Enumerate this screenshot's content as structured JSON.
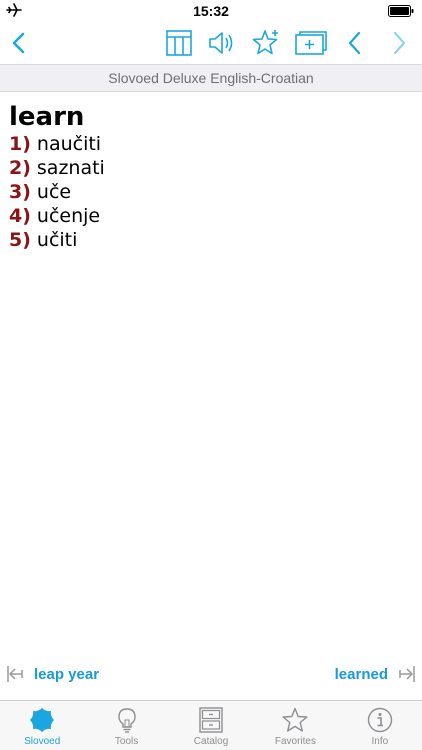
{
  "status": {
    "time": "15:32"
  },
  "toolbar": {
    "icons": [
      "back-icon",
      "table-icon",
      "speaker-icon",
      "favorite-star-icon",
      "add-card-icon",
      "prev-icon",
      "next-icon"
    ],
    "accent": "#1ba6e0"
  },
  "header": {
    "title": "Slovoed Deluxe English-Croatian"
  },
  "entry": {
    "headword": "learn",
    "senses": [
      {
        "num": "1)",
        "text": "naučiti"
      },
      {
        "num": "2)",
        "text": "saznati"
      },
      {
        "num": "3)",
        "text": "uče"
      },
      {
        "num": "4)",
        "text": "učenje"
      },
      {
        "num": "5)",
        "text": "učiti"
      }
    ],
    "number_color": "#8a1515"
  },
  "nav": {
    "prev": "leap year",
    "next": "learned"
  },
  "tabs": [
    {
      "label": "Slovoed",
      "icon": "slovoed-icon",
      "active": true
    },
    {
      "label": "Tools",
      "icon": "lightbulb-icon",
      "active": false
    },
    {
      "label": "Catalog",
      "icon": "cabinet-icon",
      "active": false
    },
    {
      "label": "Favorites",
      "icon": "star-icon",
      "active": false
    },
    {
      "label": "Info",
      "icon": "info-icon",
      "active": false
    }
  ]
}
